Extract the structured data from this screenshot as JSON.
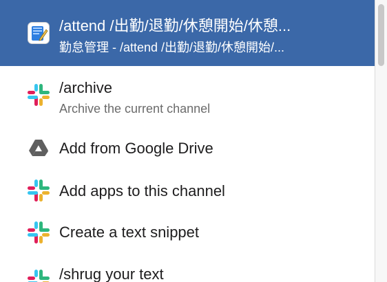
{
  "commands": [
    {
      "title": "/attend /出勤/退勤/休憩開始/休憩...",
      "subtitle": "勤怠管理 - /attend /出勤/退勤/休憩開始/...",
      "icon": "attendance-app-icon",
      "selected": true
    },
    {
      "title": "/archive",
      "subtitle": "Archive the current channel",
      "icon": "slack-icon",
      "selected": false
    },
    {
      "title": "Add from Google Drive",
      "subtitle": "",
      "icon": "google-drive-icon",
      "selected": false
    },
    {
      "title": "Add apps to this channel",
      "subtitle": "",
      "icon": "slack-icon",
      "selected": false
    },
    {
      "title": "Create a text snippet",
      "subtitle": "",
      "icon": "slack-icon",
      "selected": false
    },
    {
      "title": "/shrug your text",
      "subtitle": "",
      "icon": "slack-icon",
      "selected": false
    }
  ],
  "colors": {
    "selected_bg": "#3b68a8",
    "text": "#1d1c1d",
    "subtext": "#6b6b6b",
    "slack_blue": "#36c5f0",
    "slack_green": "#2eb67d",
    "slack_yellow": "#ecb22e",
    "slack_red": "#e01e5a",
    "drive_gray": "#5f5f5f"
  }
}
